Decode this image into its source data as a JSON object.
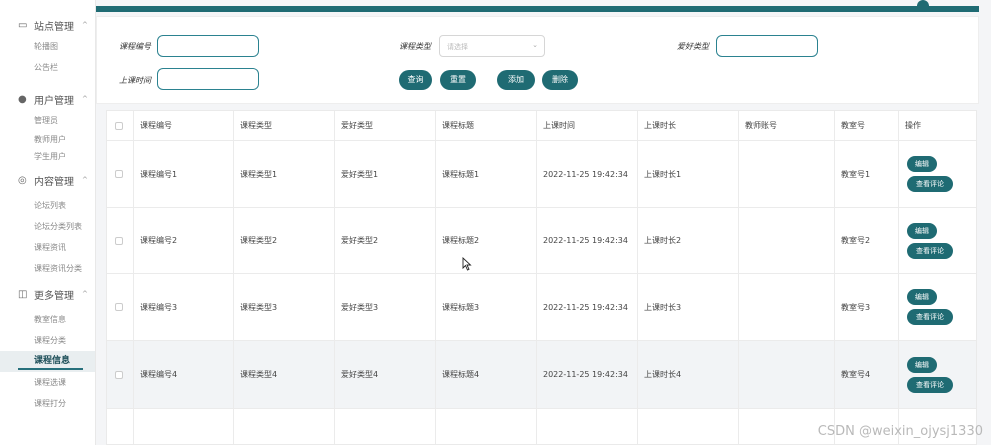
{
  "sidebar": {
    "groups": [
      {
        "icon": "monitor-icon",
        "label": "站点管理",
        "items": [
          "轮播图",
          "公告栏"
        ]
      },
      {
        "icon": "user-icon",
        "label": "用户管理",
        "items": [
          "管理员",
          "教师用户",
          "学生用户"
        ]
      },
      {
        "icon": "content-icon",
        "label": "内容管理",
        "items": [
          "论坛列表",
          "论坛分类列表",
          "课程资讯",
          "课程资讯分类"
        ]
      },
      {
        "icon": "more-icon",
        "label": "更多管理",
        "items": [
          "教室信息",
          "课程分类",
          "课程信息",
          "课程选课",
          "课程打分"
        ]
      }
    ],
    "active_item": "课程信息"
  },
  "search": {
    "course_no_label": "课程编号",
    "course_type_label": "课程类型",
    "course_type_placeholder": "请选择",
    "hobby_type_label": "爱好类型",
    "class_time_label": "上课时间",
    "query_button": "查询",
    "reset_button": "重置",
    "add_button": "添加",
    "delete_button": "删除"
  },
  "table": {
    "columns": [
      "课程编号",
      "课程类型",
      "爱好类型",
      "课程标题",
      "上课时间",
      "上课时长",
      "教师账号",
      "教室号",
      "操作"
    ],
    "rows": [
      [
        "课程编号1",
        "课程类型1",
        "爱好类型1",
        "课程标题1",
        "2022-11-25 19:42:34",
        "上课时长1",
        "",
        "教室号1"
      ],
      [
        "课程编号2",
        "课程类型2",
        "爱好类型2",
        "课程标题2",
        "2022-11-25 19:42:34",
        "上课时长2",
        "",
        "教室号2"
      ],
      [
        "课程编号3",
        "课程类型3",
        "爱好类型3",
        "课程标题3",
        "2022-11-25 19:42:34",
        "上课时长3",
        "",
        "教室号3"
      ],
      [
        "课程编号4",
        "课程类型4",
        "爱好类型4",
        "课程标题4",
        "2022-11-25 19:42:34",
        "上课时长4",
        "",
        "教室号4"
      ]
    ],
    "edit_label": "编辑",
    "view_comments_label": "查看评论"
  },
  "watermark": "CSDN @weixin_ojysj1330",
  "colors": {
    "accent": "#1f6b73",
    "active_text": "#1b4d57"
  }
}
